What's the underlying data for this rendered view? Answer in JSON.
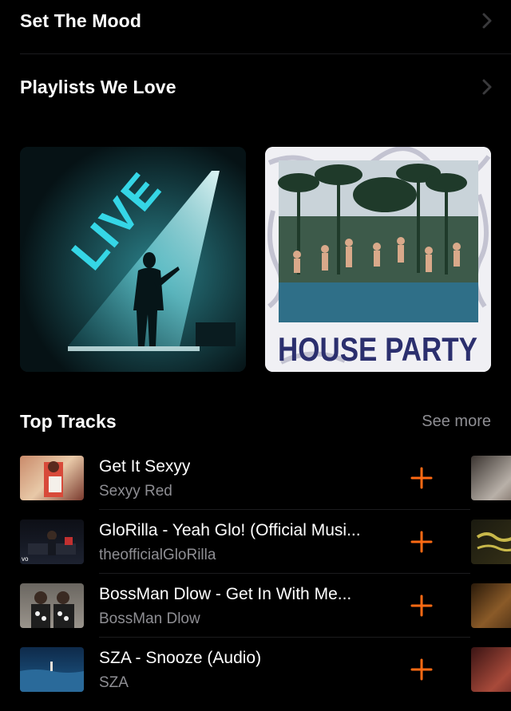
{
  "sections": {
    "set_the_mood": "Set The Mood",
    "playlists_we_love": "Playlists We Love"
  },
  "playlists": [
    {
      "label": "LIVE"
    },
    {
      "label": "HOUSE PARTY"
    }
  ],
  "top_tracks": {
    "title": "Top Tracks",
    "see_more": "See more",
    "items": [
      {
        "title": "Get It Sexyy",
        "artist": "Sexyy Red"
      },
      {
        "title": "GloRilla - Yeah Glo! (Official Musi...",
        "artist": "theofficialGloRilla"
      },
      {
        "title": "BossMan Dlow - Get In With Me...",
        "artist": "BossMan Dlow"
      },
      {
        "title": "SZA - Snooze (Audio)",
        "artist": "SZA"
      }
    ]
  },
  "colors": {
    "accent": "#ff6a13",
    "secondary_text": "#8e8e93",
    "background": "#000000"
  },
  "icons": {
    "chevron": "chevron-right-icon",
    "add": "plus-icon"
  }
}
